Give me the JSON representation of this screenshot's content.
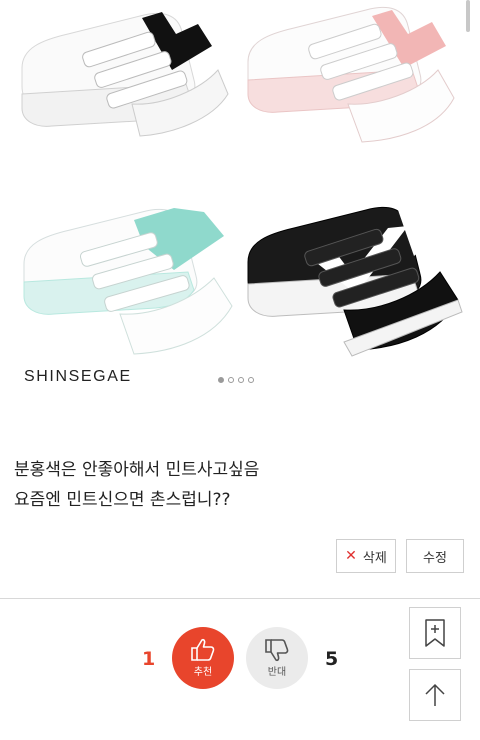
{
  "product": {
    "brand": "SHINSEGAE",
    "carousel": {
      "total": 4,
      "active_index": 0
    },
    "shoes": [
      {
        "name": "white-black-shoe-icon",
        "upper": "#ffffff",
        "accent": "#111111",
        "sole": "#ffffff"
      },
      {
        "name": "white-pink-shoe-icon",
        "upper": "#ffffff",
        "accent": "#f2b6b5",
        "sole": "#f4c4c4"
      },
      {
        "name": "white-mint-shoe-icon",
        "upper": "#ffffff",
        "accent": "#8fd9cc",
        "sole": "#b8e8df"
      },
      {
        "name": "black-white-shoe-icon",
        "upper": "#1a1a1a",
        "accent": "#ffffff",
        "sole": "#ffffff"
      }
    ]
  },
  "post": {
    "lines": [
      "분홍색은 안좋아해서 민트사고싶음",
      "요즘엔 민트신으면 촌스럽니??"
    ]
  },
  "actions": {
    "delete_label": "삭제",
    "edit_label": "수정"
  },
  "votes": {
    "up_count": "1",
    "down_count": "5",
    "recommend_label": "추천",
    "oppose_label": "반대"
  },
  "side": {
    "bookmark_icon": "bookmark-plus-icon",
    "top_icon": "arrow-up-icon"
  },
  "colors": {
    "accent": "#e8452c",
    "delete_x": "#e0302f"
  }
}
